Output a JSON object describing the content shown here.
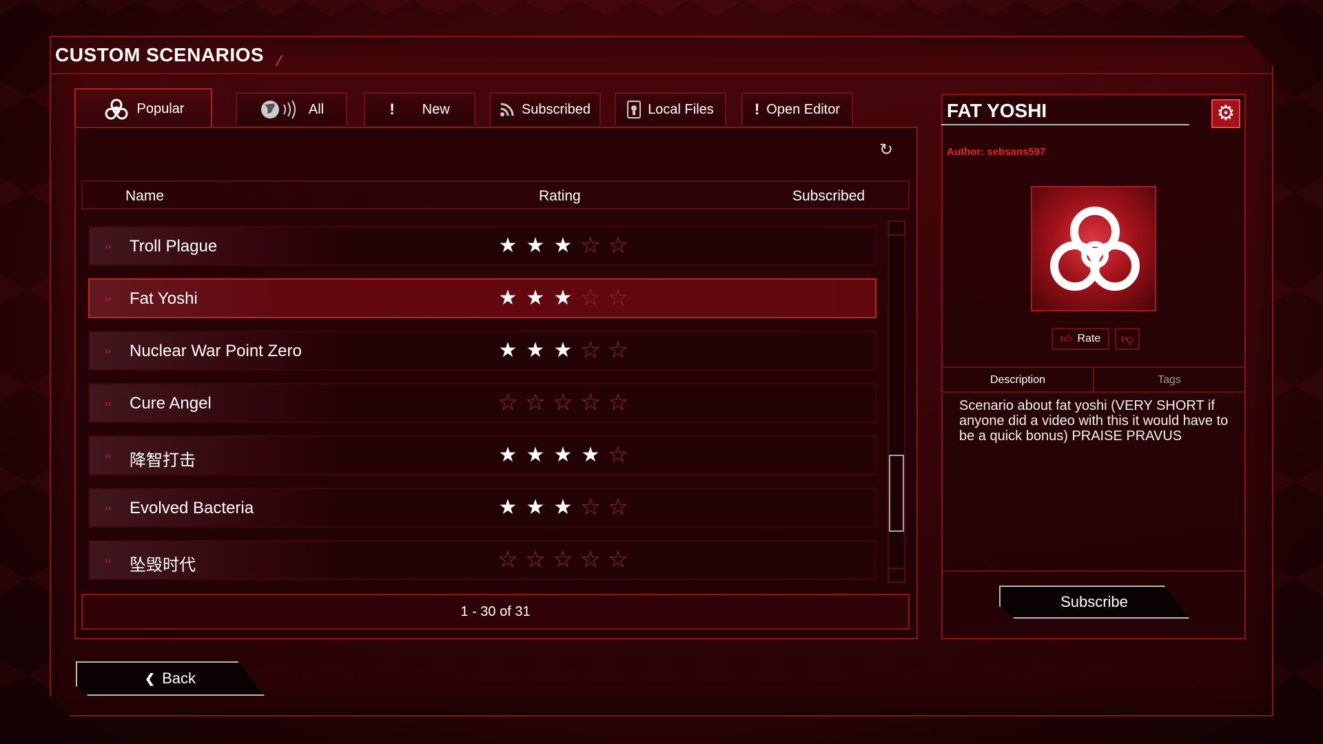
{
  "page": {
    "title": "CUSTOM SCENARIOS"
  },
  "tabs": [
    {
      "label": "Popular",
      "icon": "biohazard-icon",
      "active": true
    },
    {
      "label": "All",
      "icon": "globe-broadcast-icon",
      "active": false
    },
    {
      "label": "New",
      "icon": "exclamation-icon",
      "active": false
    },
    {
      "label": "Subscribed",
      "icon": "rss-icon",
      "active": false
    },
    {
      "label": "Local Files",
      "icon": "local-file-icon",
      "active": false
    },
    {
      "label": "Open Editor",
      "icon": "exclamation-icon",
      "active": false
    }
  ],
  "list": {
    "headers": {
      "name": "Name",
      "rating": "Rating",
      "subscribed": "Subscribed"
    },
    "rows": [
      {
        "name": "Troll Plague",
        "rating": 3,
        "selected": false
      },
      {
        "name": "Fat Yoshi",
        "rating": 3,
        "selected": true
      },
      {
        "name": "Nuclear War Point Zero",
        "rating": 3,
        "selected": false
      },
      {
        "name": "Cure Angel",
        "rating": 0,
        "selected": false
      },
      {
        "name": "降智打击",
        "rating": 4,
        "selected": false
      },
      {
        "name": "Evolved Bacteria",
        "rating": 3,
        "selected": false
      },
      {
        "name": "坠毁时代",
        "rating": 0,
        "selected": false
      }
    ],
    "max_rating": 5,
    "pager": "1 - 30 of 31"
  },
  "detail": {
    "title": "FAT YOSHI",
    "author": "Author: sebsans597",
    "rate_label": "Rate",
    "tabs": {
      "description": "Description",
      "tags": "Tags"
    },
    "description": "Scenario about fat yoshi (VERY SHORT if anyone did a video with this it would have to be a quick bonus) PRAISE PRAVUS",
    "subscribe_label": "Subscribe"
  },
  "footer": {
    "back_label": "Back"
  },
  "colors": {
    "accent": "#e0262e",
    "frame": "#8a1418",
    "background": "#3a0508"
  }
}
